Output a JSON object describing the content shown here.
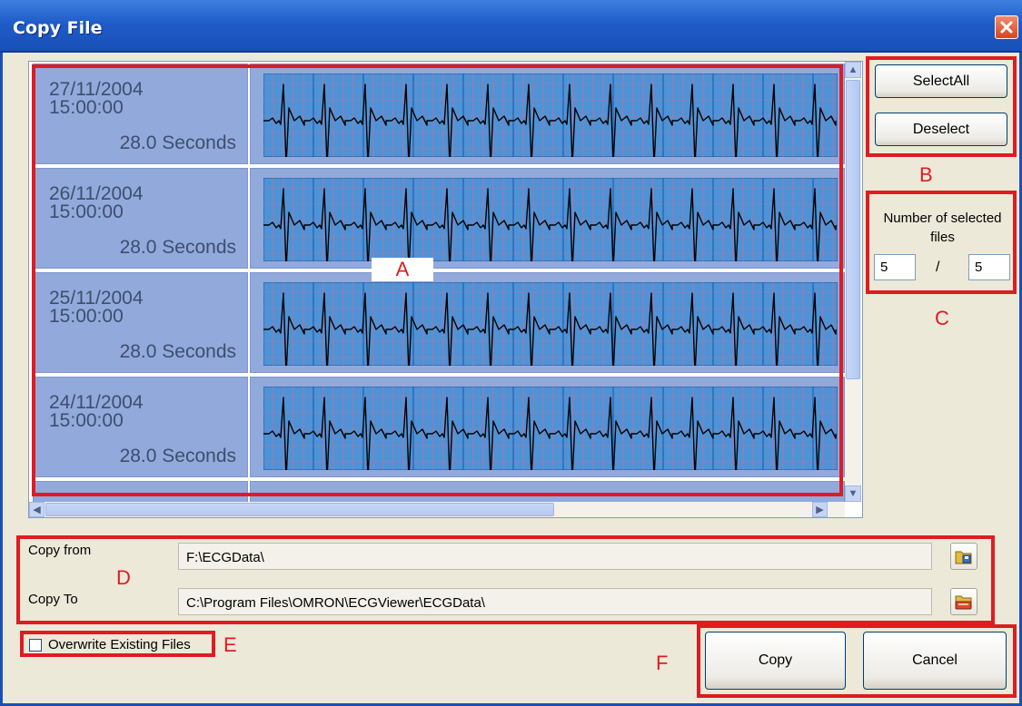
{
  "window": {
    "title": "Copy File"
  },
  "files": [
    {
      "date": "27/11/2004",
      "time": "15:00:00",
      "duration": "28.0 Seconds"
    },
    {
      "date": "26/11/2004",
      "time": "15:00:00",
      "duration": "28.0 Seconds"
    },
    {
      "date": "25/11/2004",
      "time": "15:00:00",
      "duration": "28.0 Seconds"
    },
    {
      "date": "24/11/2004",
      "time": "15:00:00",
      "duration": "28.0 Seconds"
    }
  ],
  "selection": {
    "select_all": "SelectAll",
    "deselect": "Deselect",
    "count_label": "Number of selected files",
    "selected_count": "5",
    "separator": "/",
    "total_count": "5"
  },
  "paths": {
    "from_label": "Copy from",
    "from_value": "F:\\ECGData\\",
    "to_label": "Copy To",
    "to_value": "C:\\Program Files\\OMRON\\ECGViewer\\ECGData\\"
  },
  "options": {
    "overwrite_label": "Overwrite Existing Files",
    "overwrite_checked": false
  },
  "actions": {
    "copy": "Copy",
    "cancel": "Cancel"
  },
  "annotations": {
    "a": "A",
    "b": "B",
    "c": "C",
    "d": "D",
    "e": "E",
    "f": "F"
  },
  "colors": {
    "annotation": "#e01b22",
    "title_bar": "#1e5cc8",
    "ecg_background": "#4f93d6",
    "ecg_grid": "#d86a95",
    "ecg_trace": "#000000"
  },
  "icons": {
    "close": "close-icon",
    "copy_from_browse": "folder-browse-icon",
    "copy_to_browse": "folder-browse-icon"
  }
}
